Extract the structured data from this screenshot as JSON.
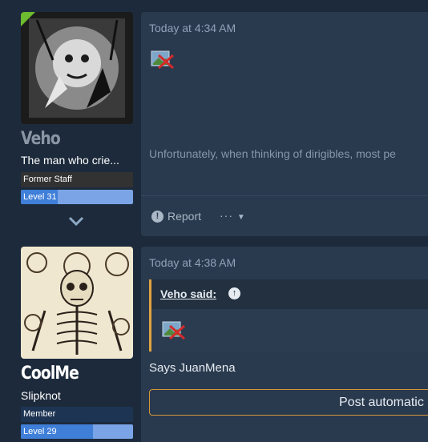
{
  "posts": [
    {
      "username": "Veho",
      "user_title": "The man who crie...",
      "banner": "Former Staff",
      "level": "Level 31",
      "level_fraction": 0.33,
      "time": "Today at 4:34 AM",
      "body_text": "Unfortunately, when thinking of dirigibles, most pe",
      "actions": {
        "report": "Report",
        "more": "···"
      }
    },
    {
      "username": "CoolMe",
      "user_title": "Slipknot",
      "banner": "Member",
      "level": "Level 29",
      "level_fraction": 0.64,
      "time": "Today at 4:38 AM",
      "quote": {
        "author": "Veho said:"
      },
      "message": "Says JuanMena",
      "button": "Post automatic"
    }
  ],
  "colors": {
    "page_bg": "#1c2a3b",
    "card_bg": "#2a3a4e",
    "accent_orange": "#e0a340",
    "level_blue": "#3f7fd8",
    "staff_badge": "#6dbb2f"
  },
  "icons": [
    "broken-image-icon",
    "alert-icon",
    "chevron-down-icon",
    "arrow-up-circle-icon",
    "ellipsis-icon",
    "caret-down-icon"
  ]
}
